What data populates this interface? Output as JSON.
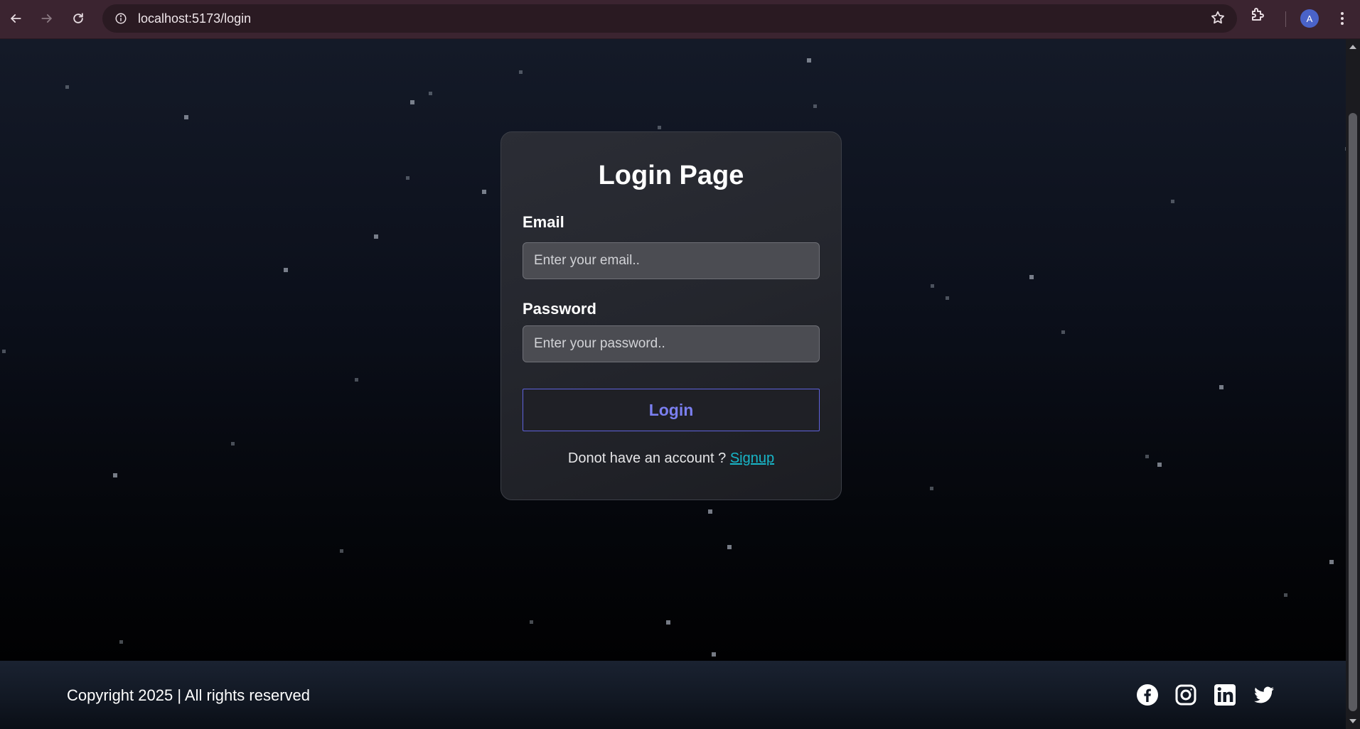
{
  "browser": {
    "url": "localhost:5173/login",
    "profile_initial": "A",
    "icons": [
      "back-arrow-icon",
      "forward-arrow-icon",
      "reload-icon",
      "site-info-icon",
      "bookmark-star-icon",
      "extensions-puzzle-icon",
      "kebab-menu-icon"
    ]
  },
  "login_card": {
    "title": "Login Page",
    "email_label": "Email",
    "email_placeholder": "Enter your email..",
    "email_value": "",
    "password_label": "Password",
    "password_placeholder": "Enter your password..",
    "password_value": "",
    "submit_label": "Login",
    "signup_prompt": "Donot have an account ?",
    "signup_link": "Signup"
  },
  "footer": {
    "copyright": "Copyright 2025 | All rights reserved",
    "social_icons": [
      "facebook-icon",
      "instagram-icon",
      "linkedin-icon",
      "twitter-icon"
    ]
  },
  "colors": {
    "chrome_background": "#3b2430",
    "page_background_top": "#141a28",
    "card_background": "#2b2d35",
    "button_accent": "#5f62dd",
    "link_color": "#18b6c8",
    "star_color": "#9ca3af"
  }
}
